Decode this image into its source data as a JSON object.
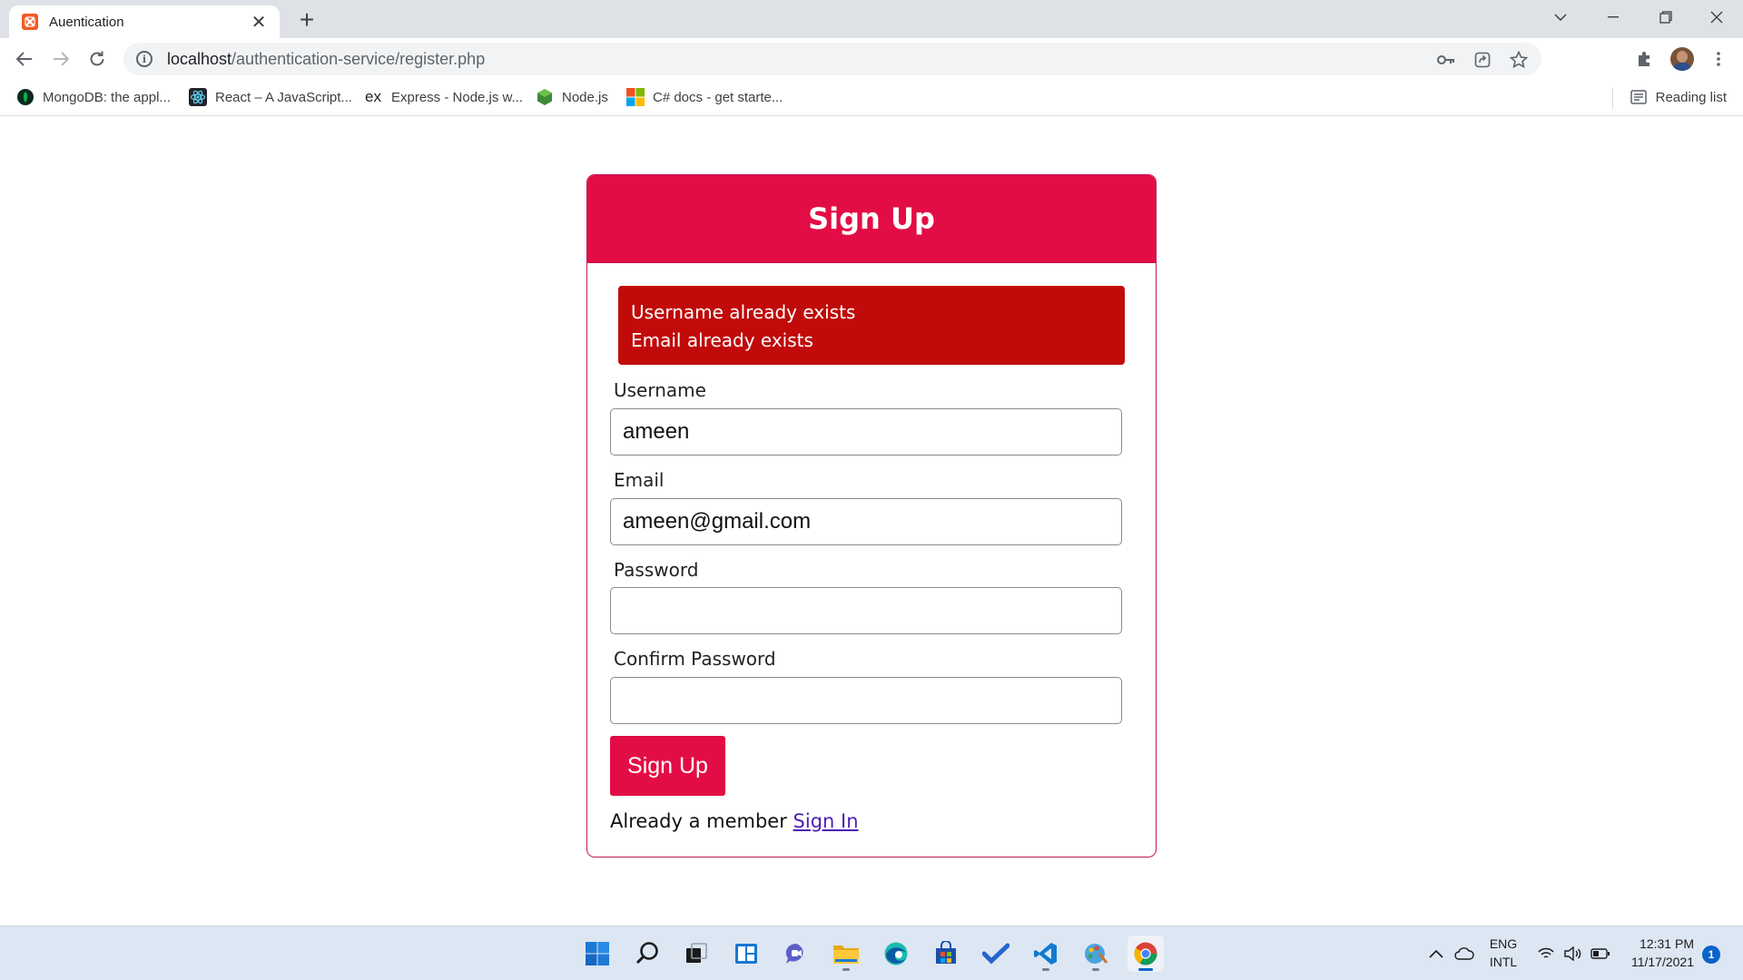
{
  "browser": {
    "tab_title": "Auentication",
    "url_host": "localhost",
    "url_path": "/authentication-service/register.php",
    "accent_color": "#dee1e6"
  },
  "bookmarks": [
    {
      "label": "MongoDB: the appl...",
      "icon": "mongodb-leaf-icon"
    },
    {
      "label": "React – A JavaScript...",
      "icon": "react-atom-icon"
    },
    {
      "label": "Express - Node.js w...",
      "icon": "express-ex-icon"
    },
    {
      "label": "Node.js",
      "icon": "nodejs-hexagon-icon"
    },
    {
      "label": "C# docs - get starte...",
      "icon": "microsoft-logo-icon"
    }
  ],
  "reading_list": "Reading list",
  "form": {
    "title": "Sign Up",
    "header_color": "#e30d45",
    "errors": [
      "Username already exists",
      "Email already exists"
    ],
    "error_color": "#c10a0a",
    "username_label": "Username",
    "username_value": "ameen",
    "email_label": "Email",
    "email_value": "ameen@gmail.com",
    "password_label": "Password",
    "password_value": "",
    "confirm_label": "Confirm Password",
    "confirm_value": "",
    "submit_label": "Sign Up",
    "member_text": "Already a member",
    "signin_link": "Sign In"
  },
  "taskbar": {
    "lang_top": "ENG",
    "lang_bottom": "INTL",
    "time": "12:31 PM",
    "date": "11/17/2021",
    "notifications": "1"
  }
}
